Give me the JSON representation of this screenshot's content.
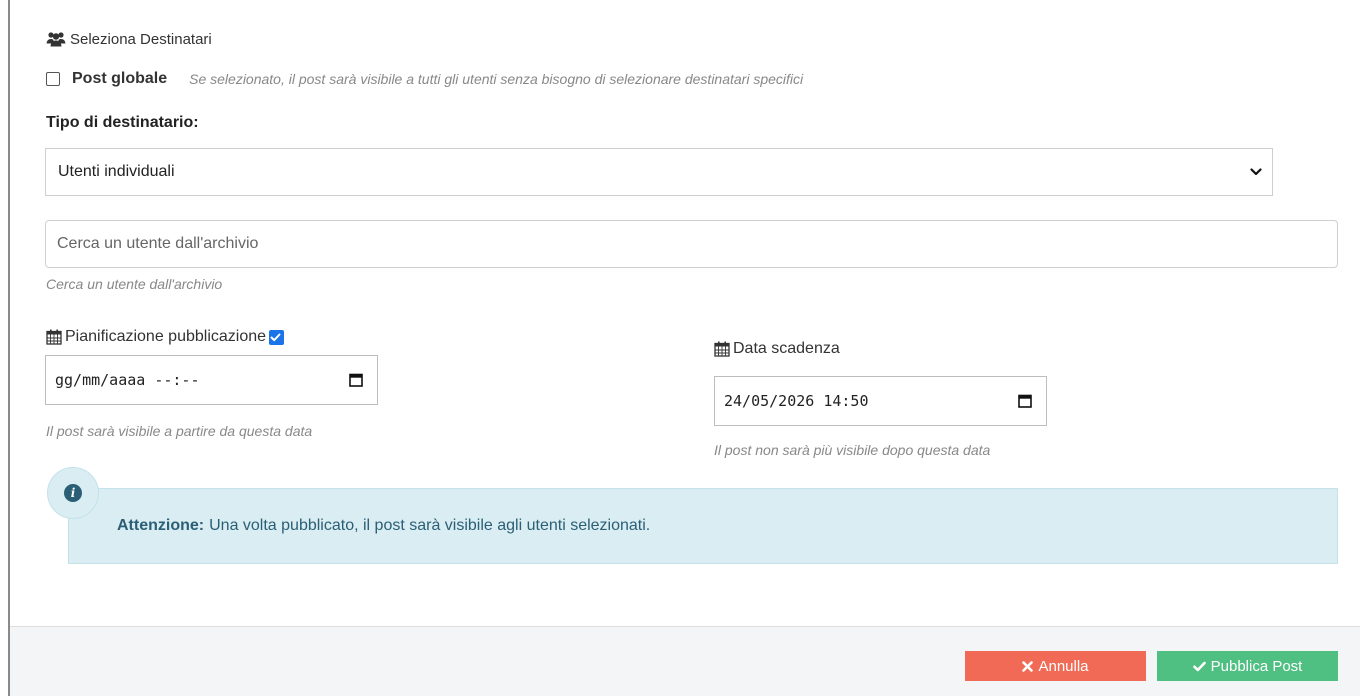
{
  "section": {
    "title": "Seleziona Destinatari",
    "icon": "users-icon"
  },
  "global_post": {
    "label": "Post globale",
    "checked": false,
    "hint": "Se selezionato, il post sarà visibile a tutti gli utenti senza bisogno di selezionare destinatari specifici"
  },
  "recipient_type": {
    "label": "Tipo di destinatario:",
    "selected": "Utenti individuali"
  },
  "user_search": {
    "placeholder": "Cerca un utente dall'archivio",
    "value": "",
    "help": "Cerca un utente dall'archivio"
  },
  "schedule": {
    "label": "Pianificazione pubblicazione",
    "enabled": true,
    "value": "gg/mm/aaaa --:--",
    "help": "Il post sarà visibile a partire da questa data"
  },
  "expiry": {
    "label": "Data scadenza",
    "value": "24/05/2026 14:50",
    "help": "Il post non sarà più visibile dopo questa data"
  },
  "alert": {
    "title": "Attenzione:",
    "message": "Una volta pubblicato, il post sarà visibile agli utenti selezionati."
  },
  "footer": {
    "cancel_label": "Annulla",
    "publish_label": "Pubblica Post"
  },
  "colors": {
    "alert_bg": "#d9edf3",
    "alert_text": "#2b5f76",
    "cancel_bg": "#f06a55",
    "publish_bg": "#4fbf82",
    "checkbox_checked": "#1a73e8"
  }
}
